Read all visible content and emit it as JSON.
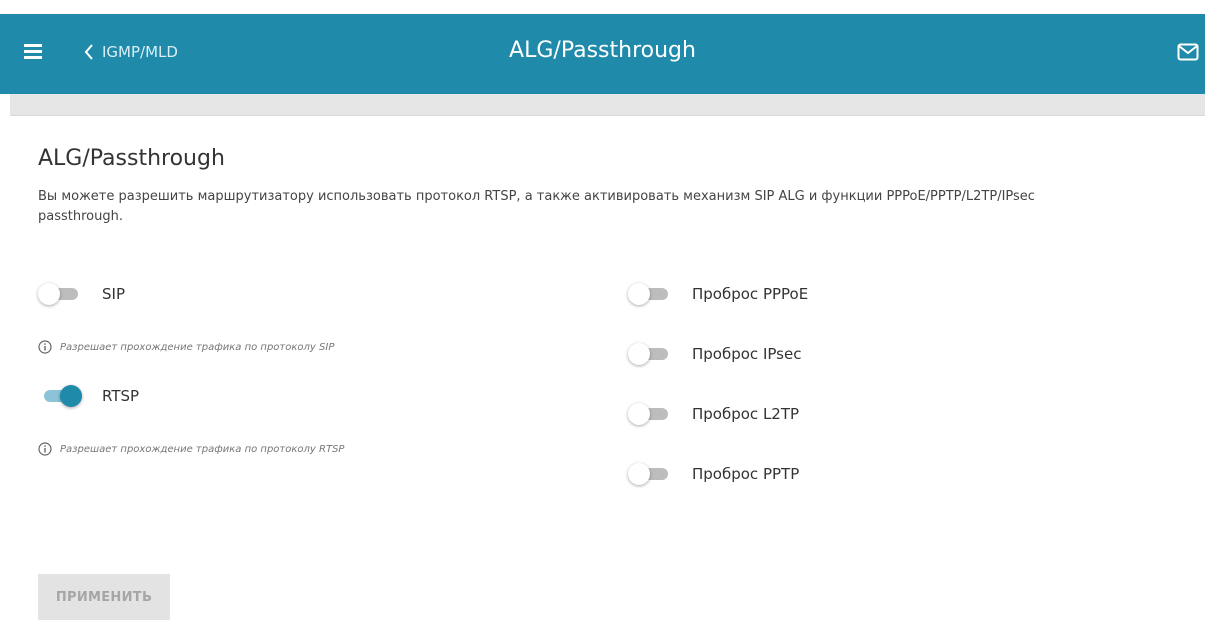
{
  "header": {
    "back_label": "IGMP/MLD",
    "title": "ALG/Passthrough"
  },
  "main": {
    "section_title": "ALG/Passthrough",
    "description": "Вы можете разрешить маршрутизатору использовать протокол RTSP, а также активировать механизм SIP ALG и функции PPPoE/PPTP/L2TP/IPsec passthrough.",
    "left": [
      {
        "label": "SIP",
        "enabled": false,
        "hint": "Разрешает прохождение трафика по протоколу SIP"
      },
      {
        "label": "RTSP",
        "enabled": true,
        "hint": "Разрешает прохождение трафика по протоколу RTSP"
      }
    ],
    "right": [
      {
        "label": "Проброс PPPoE",
        "enabled": false
      },
      {
        "label": "Проброс IPsec",
        "enabled": false
      },
      {
        "label": "Проброс L2TP",
        "enabled": false
      },
      {
        "label": "Проброс PPTP",
        "enabled": false
      }
    ],
    "apply_label": "ПРИМЕНИТЬ"
  },
  "colors": {
    "header_bg": "#1f8aaa",
    "toggle_on": "#1f8aaa",
    "toggle_off": "#bdbdbd"
  },
  "icons": {
    "menu": "hamburger-icon",
    "back": "chevron-left-icon",
    "mail": "envelope-icon",
    "info": "info-circle-icon"
  }
}
